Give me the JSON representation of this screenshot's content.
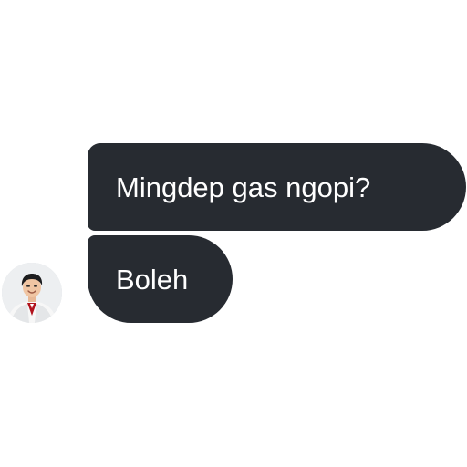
{
  "chat": {
    "messages": [
      {
        "sender": "other",
        "text": "Mingdep gas ngopi?"
      },
      {
        "sender": "other",
        "text": "Boleh"
      }
    ],
    "avatar": {
      "icon": "person-avatar-icon"
    },
    "colors": {
      "bubble_background": "#272b31",
      "bubble_text": "#ffffff",
      "page_background": "#ffffff"
    }
  }
}
